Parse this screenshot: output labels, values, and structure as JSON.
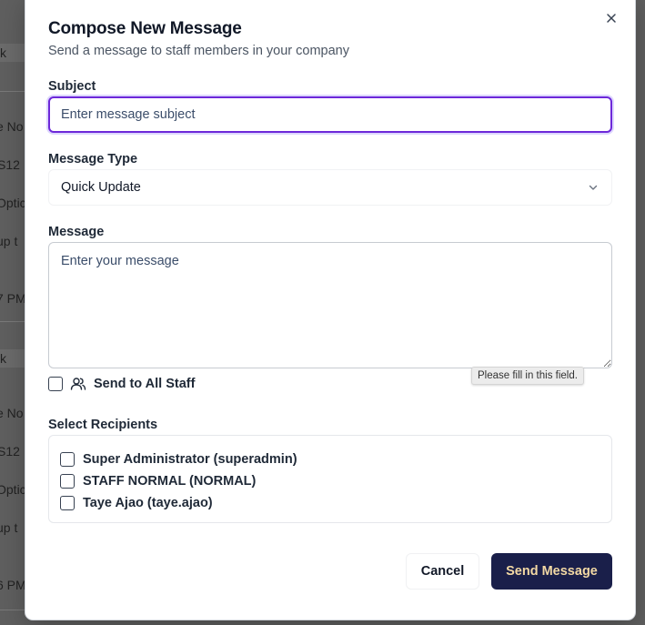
{
  "background": {
    "fragments": [
      "k",
      "e No",
      "S12",
      "Optic",
      "up t",
      "7 PM",
      "k",
      "e No",
      "S12",
      "Optic",
      "up t",
      "6 PM"
    ]
  },
  "modal": {
    "title": "Compose New Message",
    "subtitle": "Send a message to staff members in your company",
    "close_icon": "close-icon",
    "subject": {
      "label": "Subject",
      "placeholder": "Enter message subject",
      "value": ""
    },
    "message_type": {
      "label": "Message Type",
      "selected": "Quick Update",
      "icon": "chevron-down-icon"
    },
    "message": {
      "label": "Message",
      "placeholder": "Enter your message",
      "value": ""
    },
    "send_all": {
      "label": "Send to All Staff",
      "checked": false,
      "icon": "users-icon"
    },
    "validation_tooltip": "Please fill in this field.",
    "recipients": {
      "label": "Select Recipients",
      "items": [
        {
          "label": "Super Administrator (superadmin)",
          "checked": false
        },
        {
          "label": "STAFF NORMAL (NORMAL)",
          "checked": false
        },
        {
          "label": "Taye Ajao (taye.ajao)",
          "checked": false
        }
      ]
    },
    "buttons": {
      "cancel": "Cancel",
      "send": "Send Message"
    },
    "colors": {
      "focus_border": "#6d28d9",
      "primary_button_bg": "#1a1f4a",
      "primary_button_text": "#f3d9a4"
    }
  }
}
